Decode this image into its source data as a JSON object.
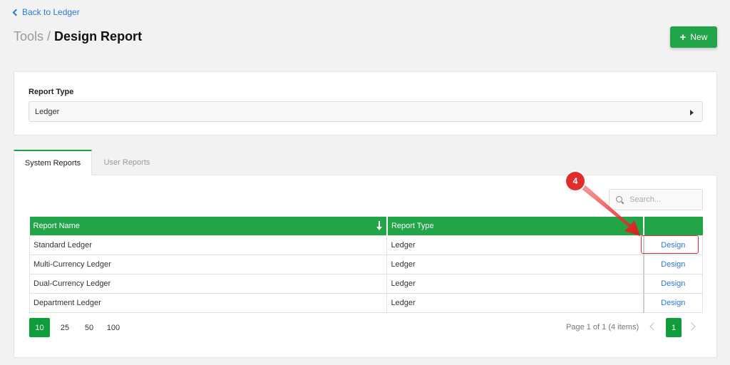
{
  "back_link": "Back to Ledger",
  "title": {
    "crumb": "Tools",
    "separator": "/",
    "current": "Design Report"
  },
  "new_button": {
    "icon": "+",
    "label": "New"
  },
  "report_type": {
    "label": "Report Type",
    "value": "Ledger"
  },
  "tabs": [
    {
      "label": "System Reports",
      "active": true
    },
    {
      "label": "User Reports",
      "active": false
    }
  ],
  "search": {
    "placeholder": "Search..."
  },
  "table": {
    "columns": [
      "Report Name",
      "Report Type",
      ""
    ],
    "rows": [
      {
        "name": "Standard Ledger",
        "type": "Ledger",
        "action": "Design"
      },
      {
        "name": "Multi-Currency Ledger",
        "type": "Ledger",
        "action": "Design"
      },
      {
        "name": "Dual-Currency Ledger",
        "type": "Ledger",
        "action": "Design"
      },
      {
        "name": "Department Ledger",
        "type": "Ledger",
        "action": "Design"
      }
    ]
  },
  "pagination": {
    "page_sizes": [
      "10",
      "25",
      "50",
      "100"
    ],
    "active_size": "10",
    "info": "Page 1 of 1 (4 items)",
    "current_page": "1"
  },
  "annotation": {
    "step": "4",
    "color": "#e12c2c"
  },
  "colors": {
    "brand_green": "#22a548",
    "link_blue": "#2a7ad0"
  }
}
